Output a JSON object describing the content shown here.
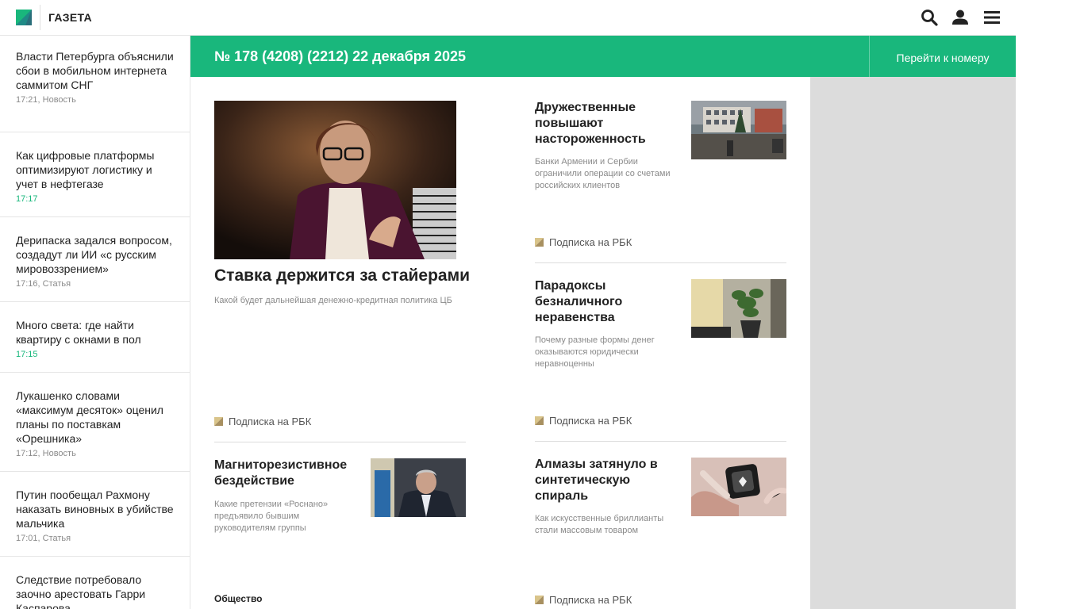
{
  "header": {
    "logo_text": "ГАЗЕТА",
    "icons": [
      "search-icon",
      "user-icon",
      "menu-icon"
    ]
  },
  "issue": {
    "title": "№ 178 (4208) (2212)  22 декабря 2025",
    "link": "Перейти к номеру"
  },
  "sidebar": {
    "items": [
      {
        "title": "Власти Петербурга объяснили сбои в мобильном интернета саммитом СНГ",
        "meta": "17:21, Новость"
      },
      {
        "title": "Как цифровые платформы оптимизируют логистику и учет в нефтегазе",
        "meta": "17:17"
      },
      {
        "title": "Дерипаска задался вопросом, создадут ли ИИ «с русским мировоззрением»",
        "meta": "17:16, Статья"
      },
      {
        "title": "Много света: где найти квартиру с окнами в пол",
        "meta": "17:15"
      },
      {
        "title": "Лукашенко словами «максимум десяток» оценил планы по поставкам «Орешника»",
        "meta": "17:12, Новость"
      },
      {
        "title": "Путин пообещал Рахмону наказать виновных в убийстве мальчика",
        "meta": "17:01, Статья"
      },
      {
        "title": "Следствие потребовало заочно арестовать Гарри Каспарова",
        "meta": ""
      }
    ]
  },
  "main": {
    "lead": {
      "title": "Ставка держится за стайерами",
      "subtitle": "Какой будет дальнейшая денежно-кредитная политика ЦБ",
      "subscription": "Подписка на РБК"
    },
    "cards": [
      {
        "title": "Дружественные повышают настороженность",
        "subtitle": "Банки Армении и Сербии ограничили операции со счетами российских клиентов",
        "subscription": "Подписка на РБК"
      },
      {
        "title": "Парадоксы безналичного неравенства",
        "subtitle": "Почему разные формы денег оказываются юридически неравноценны",
        "subscription": "Подписка на РБК"
      },
      {
        "title": "Магниторезистивное бездействие",
        "subtitle": "Какие претензии «Роснано» предъявило бывшим руководителям группы",
        "subscription": ""
      },
      {
        "title": "Алмазы затянуло в синтетическую спираль",
        "subtitle": "Как искусственные бриллианты стали массовым товаром",
        "subscription": "Подписка на РБК"
      }
    ],
    "section_label": "Общество"
  },
  "colors": {
    "accent": "#19b77c",
    "grey_panel": "#dcdcdc",
    "meta_text": "#8a8a8a",
    "subscription_icon": "#b8a46a"
  }
}
